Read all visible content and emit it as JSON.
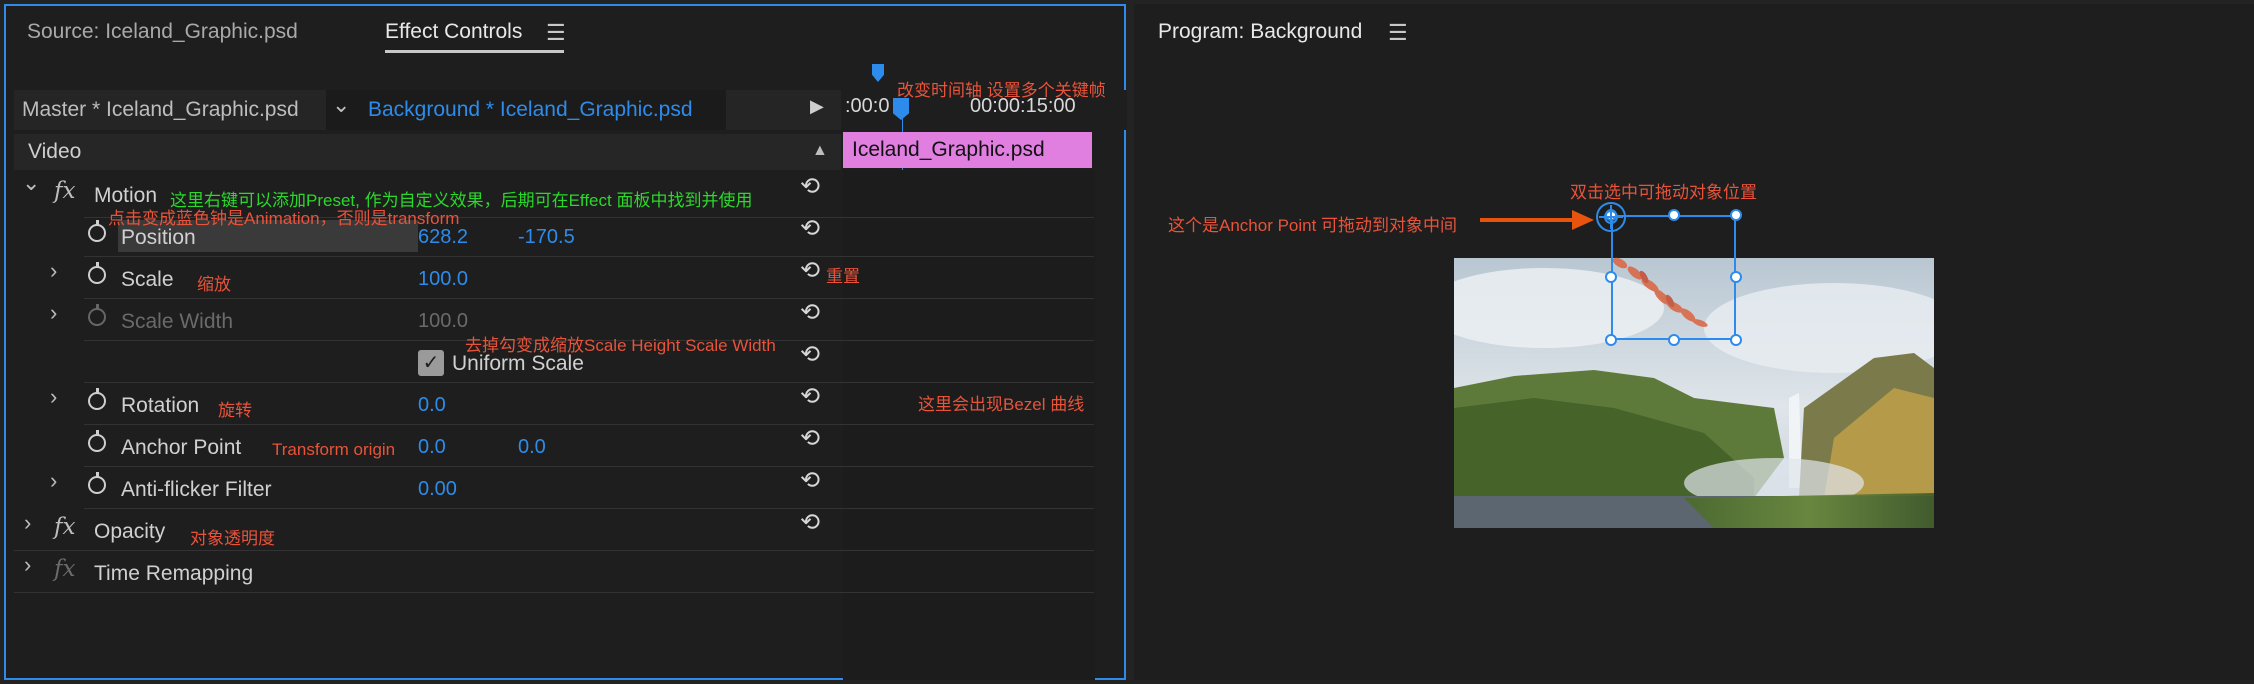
{
  "left_tabs": {
    "source": "Source: Iceland_Graphic.psd",
    "effect_controls": "Effect Controls"
  },
  "clip_bar": {
    "master": "Master * Iceland_Graphic.psd",
    "active": "Background * Iceland_Graphic.psd"
  },
  "timeline": {
    "time_left": ":00:0",
    "time_right": "00:00:15:00",
    "clip_label": "Iceland_Graphic.psd",
    "clip_color": "#e17fe0"
  },
  "effects": {
    "video_label": "Video",
    "motion": "Motion",
    "position": {
      "label": "Position",
      "x": "628.2",
      "y": "-170.5"
    },
    "scale": {
      "label": "Scale",
      "value": "100.0"
    },
    "scale_width": {
      "label": "Scale Width",
      "value": "100.0"
    },
    "uniform_scale": "Uniform Scale",
    "rotation": {
      "label": "Rotation",
      "value": "0.0"
    },
    "anchor_point": {
      "label": "Anchor Point",
      "x": "0.0",
      "y": "0.0"
    },
    "anti_flicker": {
      "label": "Anti-flicker Filter",
      "value": "0.00"
    },
    "opacity": "Opacity",
    "time_remapping": "Time Remapping"
  },
  "annotations": {
    "timeline_change": "改变时间轴 设置多个关键帧",
    "motion_preset": "这里右键可以添加Preset, 作为自定义效果，后期可在Effect 面板中找到并使用",
    "stopwatch": "点击变成蓝色钟是Animation，否则是transform",
    "reset": "重置",
    "scale": "缩放",
    "uniform": "去掉勾变成缩放Scale Height Scale Width",
    "rotation": "旋转",
    "transform_origin": "Transform origin",
    "bezel": "这里会出现Bezel 曲线",
    "opacity": "对象透明度",
    "drag_hint": "双击选中可拖动对象位置",
    "anchor_hint": "这个是Anchor Point 可拖动到对象中间"
  },
  "program": {
    "title": "Program: Background"
  },
  "colors": {
    "accent": "#2d8ceb",
    "annotation_red": "#e8533a",
    "annotation_green": "#2bd82b",
    "arrow": "#e8530e"
  },
  "icons": {
    "menu": "☰",
    "chevron_down": "⌄",
    "chevron_right": "›",
    "play": "▶",
    "up": "▲",
    "reset": "⟲",
    "check": "✓"
  }
}
